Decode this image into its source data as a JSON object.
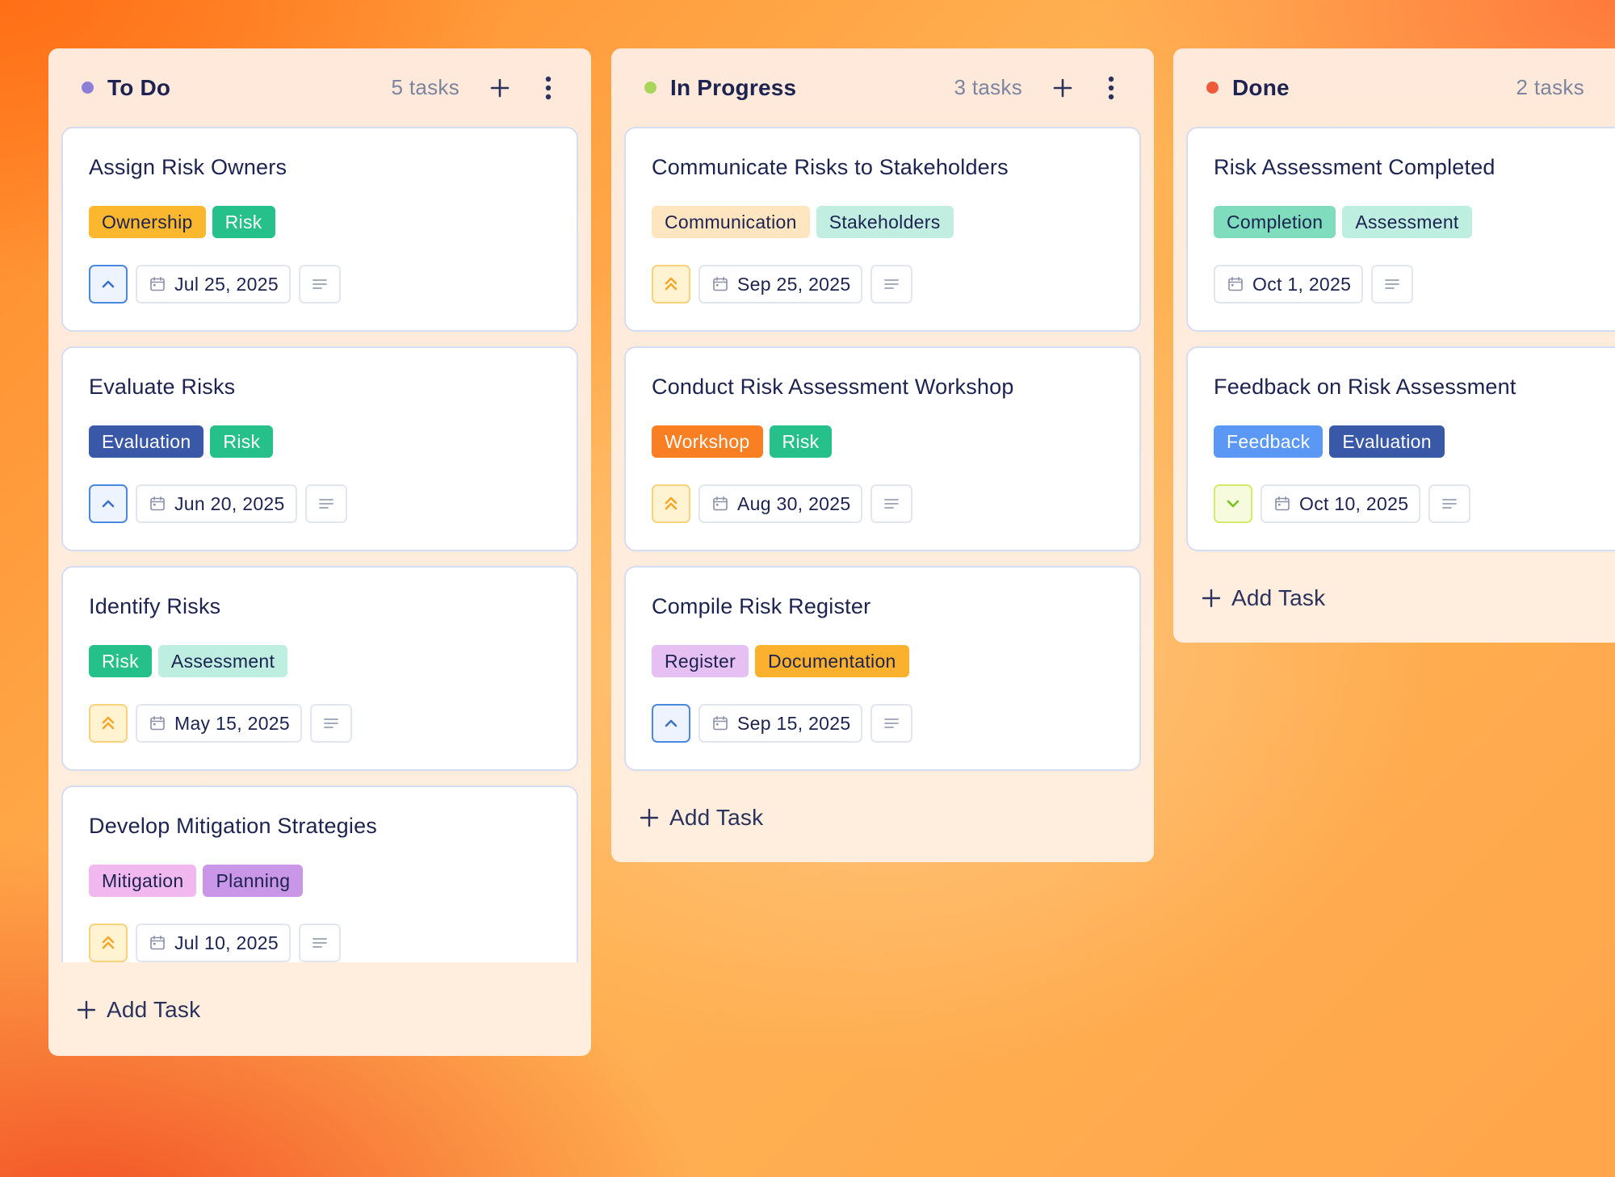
{
  "colors": {
    "dot_todo": "#8d7ed8",
    "dot_progress": "#a9d65a",
    "dot_done": "#ef5a3b"
  },
  "add_task_label": "Add Task",
  "columns": [
    {
      "title": "To Do",
      "count": "5 tasks",
      "cards": [
        {
          "title": "Assign Risk Owners",
          "tags": [
            {
              "label": "Ownership",
              "bg": "#fbb72d",
              "fg": "#1c2350"
            },
            {
              "label": "Risk",
              "bg": "#26c08a",
              "fg": "#ffffff"
            }
          ],
          "priority": "medium",
          "date": "Jul 25, 2025"
        },
        {
          "title": "Evaluate Risks",
          "tags": [
            {
              "label": "Evaluation",
              "bg": "#3a58a8",
              "fg": "#ffffff"
            },
            {
              "label": "Risk",
              "bg": "#26c08a",
              "fg": "#ffffff"
            }
          ],
          "priority": "medium",
          "date": "Jun 20, 2025"
        },
        {
          "title": "Identify Risks",
          "tags": [
            {
              "label": "Risk",
              "bg": "#26c08a",
              "fg": "#ffffff"
            },
            {
              "label": "Assessment",
              "bg": "#bdeee0",
              "fg": "#1c2350"
            }
          ],
          "priority": "high",
          "date": "May 15, 2025"
        },
        {
          "title": "Develop Mitigation Strategies",
          "tags": [
            {
              "label": "Mitigation",
              "bg": "#f0b8ee",
              "fg": "#1c2350"
            },
            {
              "label": "Planning",
              "bg": "#c996e8",
              "fg": "#1c2350"
            }
          ],
          "priority": "high",
          "date": "Jul 10, 2025"
        }
      ]
    },
    {
      "title": "In Progress",
      "count": "3 tasks",
      "cards": [
        {
          "title": "Communicate Risks to Stakeholders",
          "tags": [
            {
              "label": "Communication",
              "bg": "#ffe5c0",
              "fg": "#1c2350"
            },
            {
              "label": "Stakeholders",
              "bg": "#c2eee1",
              "fg": "#1c2350"
            }
          ],
          "priority": "high",
          "date": "Sep 25, 2025"
        },
        {
          "title": "Conduct Risk Assessment Workshop",
          "tags": [
            {
              "label": "Workshop",
              "bg": "#fa7e22",
              "fg": "#ffffff"
            },
            {
              "label": "Risk",
              "bg": "#26c08a",
              "fg": "#ffffff"
            }
          ],
          "priority": "high",
          "date": "Aug 30, 2025"
        },
        {
          "title": "Compile Risk Register",
          "tags": [
            {
              "label": "Register",
              "bg": "#e6c0f3",
              "fg": "#1c2350"
            },
            {
              "label": "Documentation",
              "bg": "#fbb12e",
              "fg": "#1c2350"
            }
          ],
          "priority": "medium",
          "date": "Sep 15, 2025"
        }
      ]
    },
    {
      "title": "Done",
      "count": "2 tasks",
      "cards": [
        {
          "title": "Risk Assessment Completed",
          "tags": [
            {
              "label": "Completion",
              "bg": "#7fdcbd",
              "fg": "#1c2350"
            },
            {
              "label": "Assessment",
              "bg": "#bdeee0",
              "fg": "#1c2350"
            }
          ],
          "priority": "",
          "date": "Oct 1, 2025"
        },
        {
          "title": "Feedback on Risk Assessment",
          "tags": [
            {
              "label": "Feedback",
              "bg": "#5b97f5",
              "fg": "#ffffff"
            },
            {
              "label": "Evaluation",
              "bg": "#3a58a8",
              "fg": "#ffffff"
            }
          ],
          "priority": "low",
          "date": "Oct 10, 2025"
        }
      ]
    }
  ]
}
